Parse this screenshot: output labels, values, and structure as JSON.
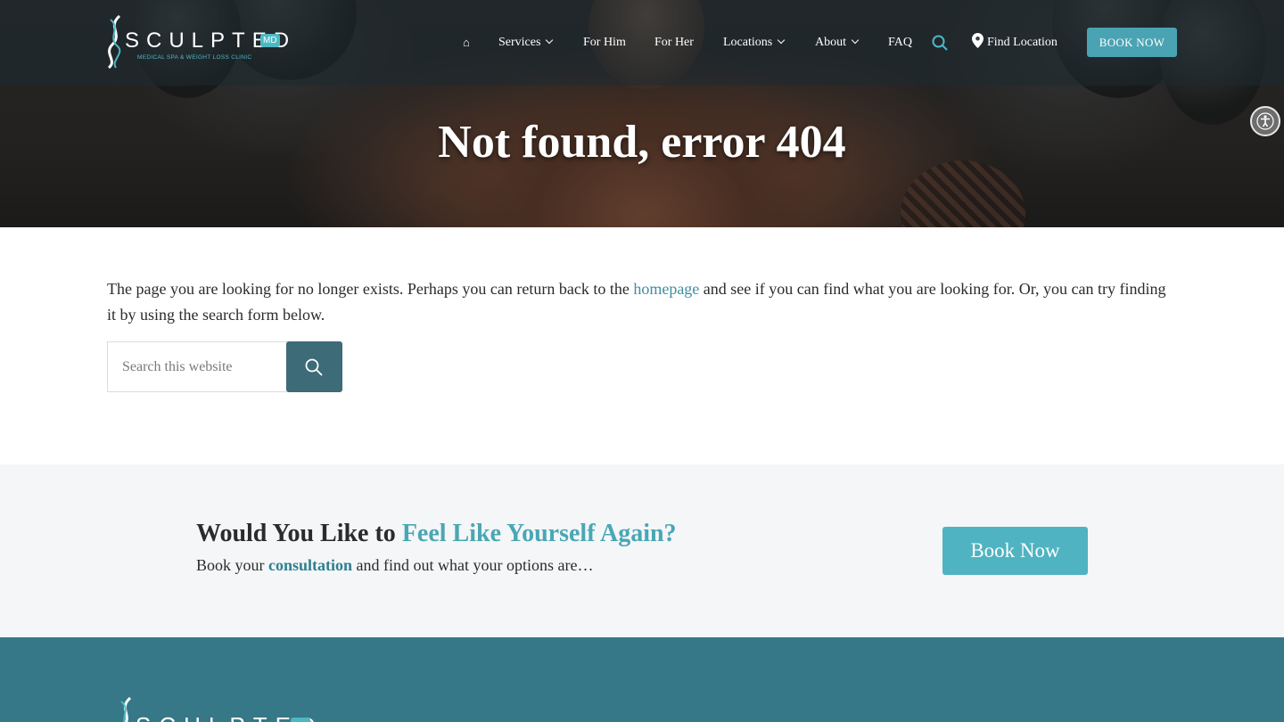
{
  "brand": {
    "name": "SCULPTED",
    "badge": "MD",
    "tagline": "MEDICAL SPA & WEIGHT LOSS CLINIC"
  },
  "nav": {
    "home_icon": "⌂",
    "items": [
      {
        "label": "Services",
        "dropdown": true
      },
      {
        "label": "For Him",
        "dropdown": false
      },
      {
        "label": "For Her",
        "dropdown": false
      },
      {
        "label": "Locations",
        "dropdown": true
      },
      {
        "label": "About",
        "dropdown": true
      },
      {
        "label": "FAQ",
        "dropdown": false
      }
    ],
    "find_location": "Find Location",
    "book_now": "BOOK NOW"
  },
  "hero": {
    "title": "Not found, error 404"
  },
  "content": {
    "message_before": "The page you are looking for no longer exists. Perhaps you can return back to the ",
    "homepage_link": "homepage",
    "message_after": " and see if you can find what you are looking for. Or, you can try finding it by using the search form below.",
    "search_placeholder": "Search this website"
  },
  "cta": {
    "title_plain": "Would You Like to ",
    "title_accent": "Feel Like Yourself Again?",
    "sub_before": "Book your ",
    "sub_link": "consultation",
    "sub_after": " and find out what your options are…",
    "button": "Book Now"
  },
  "colors": {
    "accent": "#4aa7b4",
    "dark_teal": "#3d6b78",
    "footer_bg": "#367788",
    "cta_bg": "#f4f6f8"
  },
  "icons": {
    "search": "search-icon",
    "location": "map-pin-icon",
    "accessibility": "accessibility-icon",
    "home": "home-icon"
  }
}
